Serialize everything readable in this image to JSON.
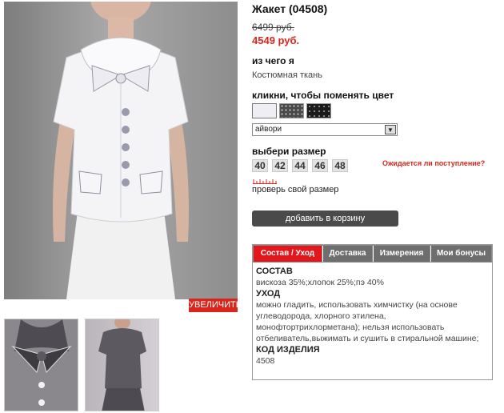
{
  "product": {
    "title": "Жакет (04508)",
    "old_price": "6499 руб.",
    "new_price": "4549 руб."
  },
  "material": {
    "label": "из чего я",
    "value": "Костюмная ткань"
  },
  "color": {
    "label": "кликни, чтобы поменять цвет",
    "selected": "айвори",
    "swatches": [
      {
        "name": "ivory",
        "color": "#eeeef4"
      },
      {
        "name": "grey-dot",
        "color": "#4a4a4a"
      },
      {
        "name": "black-dot",
        "color": "#1b1b1b"
      }
    ]
  },
  "size": {
    "label": "выбери размер",
    "options": [
      "40",
      "42",
      "44",
      "46",
      "48"
    ],
    "expected_link": "Ожидается ли поступление?",
    "check_link": "проверь свой размер"
  },
  "zoom_label": "УВЕЛИЧИТЬ",
  "cart_label": "добавить в корзину",
  "tabs": [
    "Состав / Уход",
    "Доставка",
    "Измерения",
    "Мои бонусы"
  ],
  "composition": {
    "heading": "СОСТАВ",
    "text": "вискоза 35%;хлопок 25%;пэ 40%",
    "care_heading": "УХОД",
    "care_text": "можно гладить, использовать химчистку (на основе углеводорода, хлорного этилена, монофтортрихлорметана); нельзя использовать отбеливатель,выжимать и сушить в стиральной машине;",
    "code_heading": "КОД ИЗДЕЛИЯ",
    "code": "4508"
  },
  "colors": {
    "accent": "#d9261c",
    "tab_active": "#e3171b",
    "button": "#4a4a4a"
  }
}
